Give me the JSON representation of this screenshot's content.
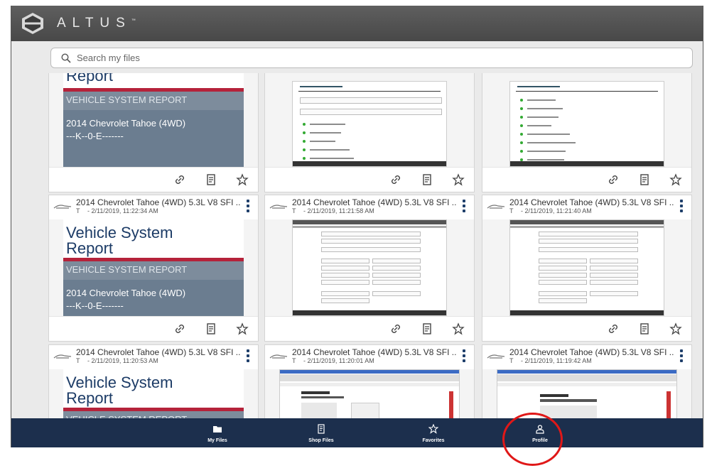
{
  "app": {
    "brand": "ALTUS",
    "trademark": "™"
  },
  "search": {
    "placeholder": "Search my files"
  },
  "report_thumb": {
    "title_line1": "Vehicle System",
    "title_line2": "Report",
    "band": "VEHICLE SYSTEM REPORT",
    "vehicle": "2014  Chevrolet  Tahoe (4WD)",
    "code": "---K--0-E-------"
  },
  "cards_row1": [
    {
      "thumb": "report"
    },
    {
      "thumb": "list"
    },
    {
      "thumb": "list"
    }
  ],
  "cards": [
    {
      "title": "2014 Chevrolet Tahoe (4WD) 5.3L V8 SFI ...",
      "sub_t": "T",
      "date": "- 2/11/2019, 11:22:34 AM",
      "thumb": "report"
    },
    {
      "title": "2014 Chevrolet Tahoe (4WD) 5.3L V8 SFI ...",
      "sub_t": "T",
      "date": "- 2/11/2019, 11:21:58 AM",
      "thumb": "grid"
    },
    {
      "title": "2014 Chevrolet Tahoe (4WD) 5.3L V8 SFI ...",
      "sub_t": "T",
      "date": "- 2/11/2019, 11:21:40 AM",
      "thumb": "grid"
    },
    {
      "title": "2014 Chevrolet Tahoe (4WD) 5.3L V8 SFI ...",
      "sub_t": "T",
      "date": "- 2/11/2019, 11:20:53 AM",
      "thumb": "report"
    },
    {
      "title": "2014 Chevrolet Tahoe (4WD) 5.3L V8 SFI ...",
      "sub_t": "T",
      "date": "- 2/11/2019, 11:20:01 AM",
      "thumb": "browser"
    },
    {
      "title": "2014 Chevrolet Tahoe (4WD) 5.3L V8 SFI ...",
      "sub_t": "T",
      "date": "- 2/11/2019, 11:19:42 AM",
      "thumb": "browser"
    }
  ],
  "nav": {
    "my_files": "My Files",
    "shop_files": "Shop Files",
    "favorites": "Favorites",
    "profile": "Profile"
  },
  "icons": [
    "logo-icon",
    "search-icon",
    "link-icon",
    "document-icon",
    "star-icon",
    "kebab-menu-icon",
    "folder-icon",
    "user-icon"
  ],
  "colors": {
    "nav_bg": "#1c2f4d",
    "topbar": "#505050",
    "accent_red": "#e01818",
    "report_blue": "#1c3b66"
  }
}
